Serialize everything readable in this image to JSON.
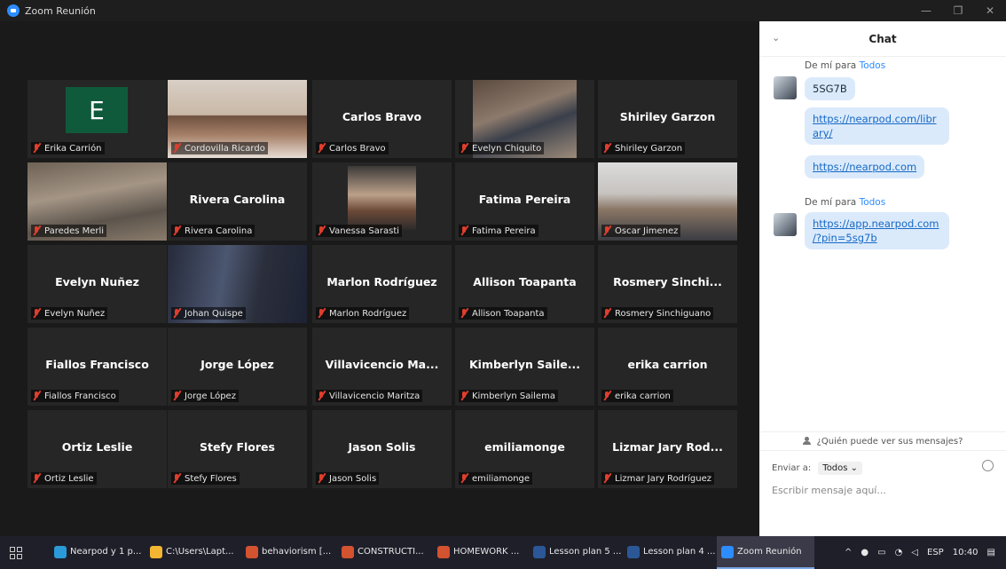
{
  "window": {
    "title": "Zoom Reunión",
    "controls": [
      "—",
      "❐",
      "✕"
    ]
  },
  "participants": [
    {
      "display": "",
      "caption": "Erika Carrión",
      "kind": "avatar",
      "letter": "E"
    },
    {
      "display": "",
      "caption": "Cordovilla Ricardo",
      "kind": "video",
      "active": true
    },
    {
      "display": "Carlos Bravo",
      "caption": "Carlos Bravo",
      "kind": "name"
    },
    {
      "display": "",
      "caption": "Evelyn Chiquito",
      "kind": "video"
    },
    {
      "display": "Shiriley Garzon",
      "caption": "Shiriley Garzon",
      "kind": "name"
    },
    {
      "display": "",
      "caption": "Paredes Merli",
      "kind": "video"
    },
    {
      "display": "Rivera Carolina",
      "caption": "Rivera Carolina",
      "kind": "name"
    },
    {
      "display": "",
      "caption": "Vanessa Sarasti",
      "kind": "video"
    },
    {
      "display": "Fatima Pereira",
      "caption": "Fatima Pereira",
      "kind": "name"
    },
    {
      "display": "",
      "caption": "Oscar Jimenez",
      "kind": "video"
    },
    {
      "display": "Evelyn Nuñez",
      "caption": "Evelyn Nuñez",
      "kind": "name"
    },
    {
      "display": "",
      "caption": "Johan Quispe",
      "kind": "video"
    },
    {
      "display": "Marlon Rodríguez",
      "caption": "Marlon Rodríguez",
      "kind": "name"
    },
    {
      "display": "Allison Toapanta",
      "caption": "Allison Toapanta",
      "kind": "name"
    },
    {
      "display": "Rosmery  Sinchi...",
      "caption": "Rosmery Sinchiguano",
      "kind": "name"
    },
    {
      "display": "Fiallos Francisco",
      "caption": "Fiallos Francisco",
      "kind": "name"
    },
    {
      "display": "Jorge López",
      "caption": "Jorge López",
      "kind": "name"
    },
    {
      "display": "Villavicencio  Ma...",
      "caption": "Villavicencio Maritza",
      "kind": "name"
    },
    {
      "display": "Kimberlyn  Saile...",
      "caption": "Kimberlyn Sailema",
      "kind": "name"
    },
    {
      "display": "erika carrion",
      "caption": "erika carrion",
      "kind": "name"
    },
    {
      "display": "Ortiz Leslie",
      "caption": "Ortiz Leslie",
      "kind": "name"
    },
    {
      "display": "Stefy Flores",
      "caption": "Stefy Flores",
      "kind": "name"
    },
    {
      "display": "Jason Solis",
      "caption": "Jason Solis",
      "kind": "name"
    },
    {
      "display": "emiliamonge",
      "caption": "emiliamonge",
      "kind": "name"
    },
    {
      "display": "Lizmar Jary Rod...",
      "caption": "Lizmar Jary Rodríguez",
      "kind": "name"
    }
  ],
  "chat": {
    "title": "Chat",
    "collapse_icon": "chevron-down-icon",
    "groups": [
      {
        "from": "De mí para",
        "to": "Todos",
        "messages": [
          "5SG7B",
          "https://nearpod.com/library/",
          "https://nearpod.com"
        ]
      },
      {
        "from": "De mí para",
        "to": "Todos",
        "messages": [
          "https://app.nearpod.com/?pin=5sg7b"
        ]
      }
    ],
    "link_lines": {
      "library": [
        "https://nearpod.com/libr",
        "ary/"
      ],
      "pin": [
        "https://app.nearpod.com",
        "/?pin=5sg7b"
      ]
    },
    "who_can_see": "¿Quién puede ver sus mensajes?",
    "send_to_label": "Enviar a:",
    "send_to_value": "Todos",
    "input_placeholder": "Escribir mensaje aquí..."
  },
  "taskbar": {
    "items": [
      {
        "label": "Nearpod y 1 p...",
        "icon": "chrome-icon",
        "color": "#2a9bd8"
      },
      {
        "label": "C:\\Users\\Lapt...",
        "icon": "folder-icon",
        "color": "#f2b632"
      },
      {
        "label": "behaviorism [...",
        "icon": "powerpoint-icon",
        "color": "#d35230"
      },
      {
        "label": "CONSTRUCTI...",
        "icon": "powerpoint-icon",
        "color": "#d35230"
      },
      {
        "label": "HOMEWORK ...",
        "icon": "powerpoint-icon",
        "color": "#d35230"
      },
      {
        "label": "Lesson plan 5 ...",
        "icon": "word-icon",
        "color": "#2b5797"
      },
      {
        "label": "Lesson plan 4 ...",
        "icon": "word-icon",
        "color": "#2b5797"
      },
      {
        "label": "Zoom Reunión",
        "icon": "zoom-icon",
        "color": "#2d8cff",
        "active": true
      }
    ],
    "tray": {
      "caret": "^",
      "lang": "ESP",
      "time": "10:40"
    }
  },
  "colors": {
    "accent": "#2d8cff",
    "active_border": "#b7e06a",
    "muted_mic": "#e03e2d",
    "tile_bg": "#262626"
  }
}
